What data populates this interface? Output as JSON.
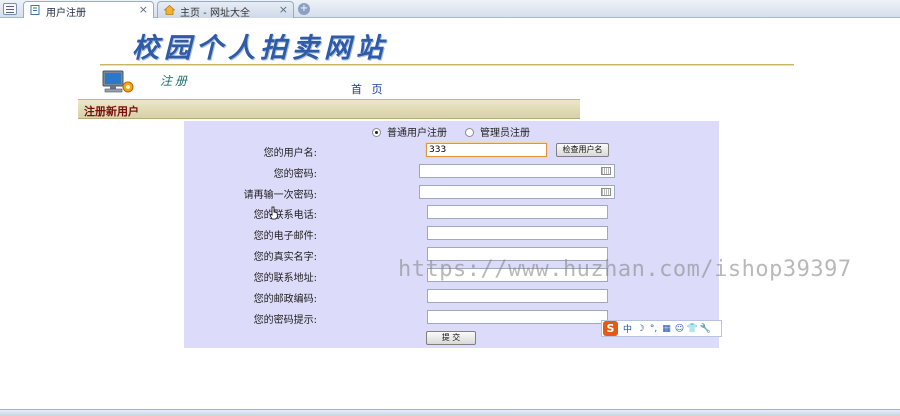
{
  "browser": {
    "active_tab": "用户注册",
    "other_tab": "主页 - 网址大全",
    "close_glyph": "×",
    "new_tab_glyph": "+"
  },
  "header": {
    "site_title": "校园个人拍卖网站",
    "register_tag": "注册",
    "nav_home": "首 页"
  },
  "section": {
    "title": "注册新用户"
  },
  "form": {
    "user_type_options": [
      {
        "label": "普通用户注册",
        "checked": true
      },
      {
        "label": "管理员注册",
        "checked": false
      }
    ],
    "fields": [
      {
        "label": "您的用户名:",
        "value": "333"
      },
      {
        "label": "您的密码:",
        "value": ""
      },
      {
        "label": "请再输一次密码:",
        "value": ""
      },
      {
        "label": "您的联系电话:",
        "value": ""
      },
      {
        "label": "您的电子邮件:",
        "value": ""
      },
      {
        "label": "您的真实名字:",
        "value": ""
      },
      {
        "label": "您的联系地址:",
        "value": ""
      },
      {
        "label": "您的邮政编码:",
        "value": ""
      },
      {
        "label": "您的密码提示:",
        "value": ""
      }
    ],
    "check_username_button": "检查用户名",
    "submit_button": "提 交"
  },
  "ime": {
    "logo": "S",
    "items": [
      "中",
      "☽",
      "°,",
      "▦",
      "☺",
      "👕",
      "🔧"
    ]
  },
  "watermark": "https://www.huzhan.com/ishop39397",
  "colors": {
    "form_background": "#dcdcfa",
    "section_bar": "#d7d1a6",
    "section_title": "#7a0f0f",
    "site_title": "#2f5aa6",
    "focus_border": "#e69436"
  }
}
